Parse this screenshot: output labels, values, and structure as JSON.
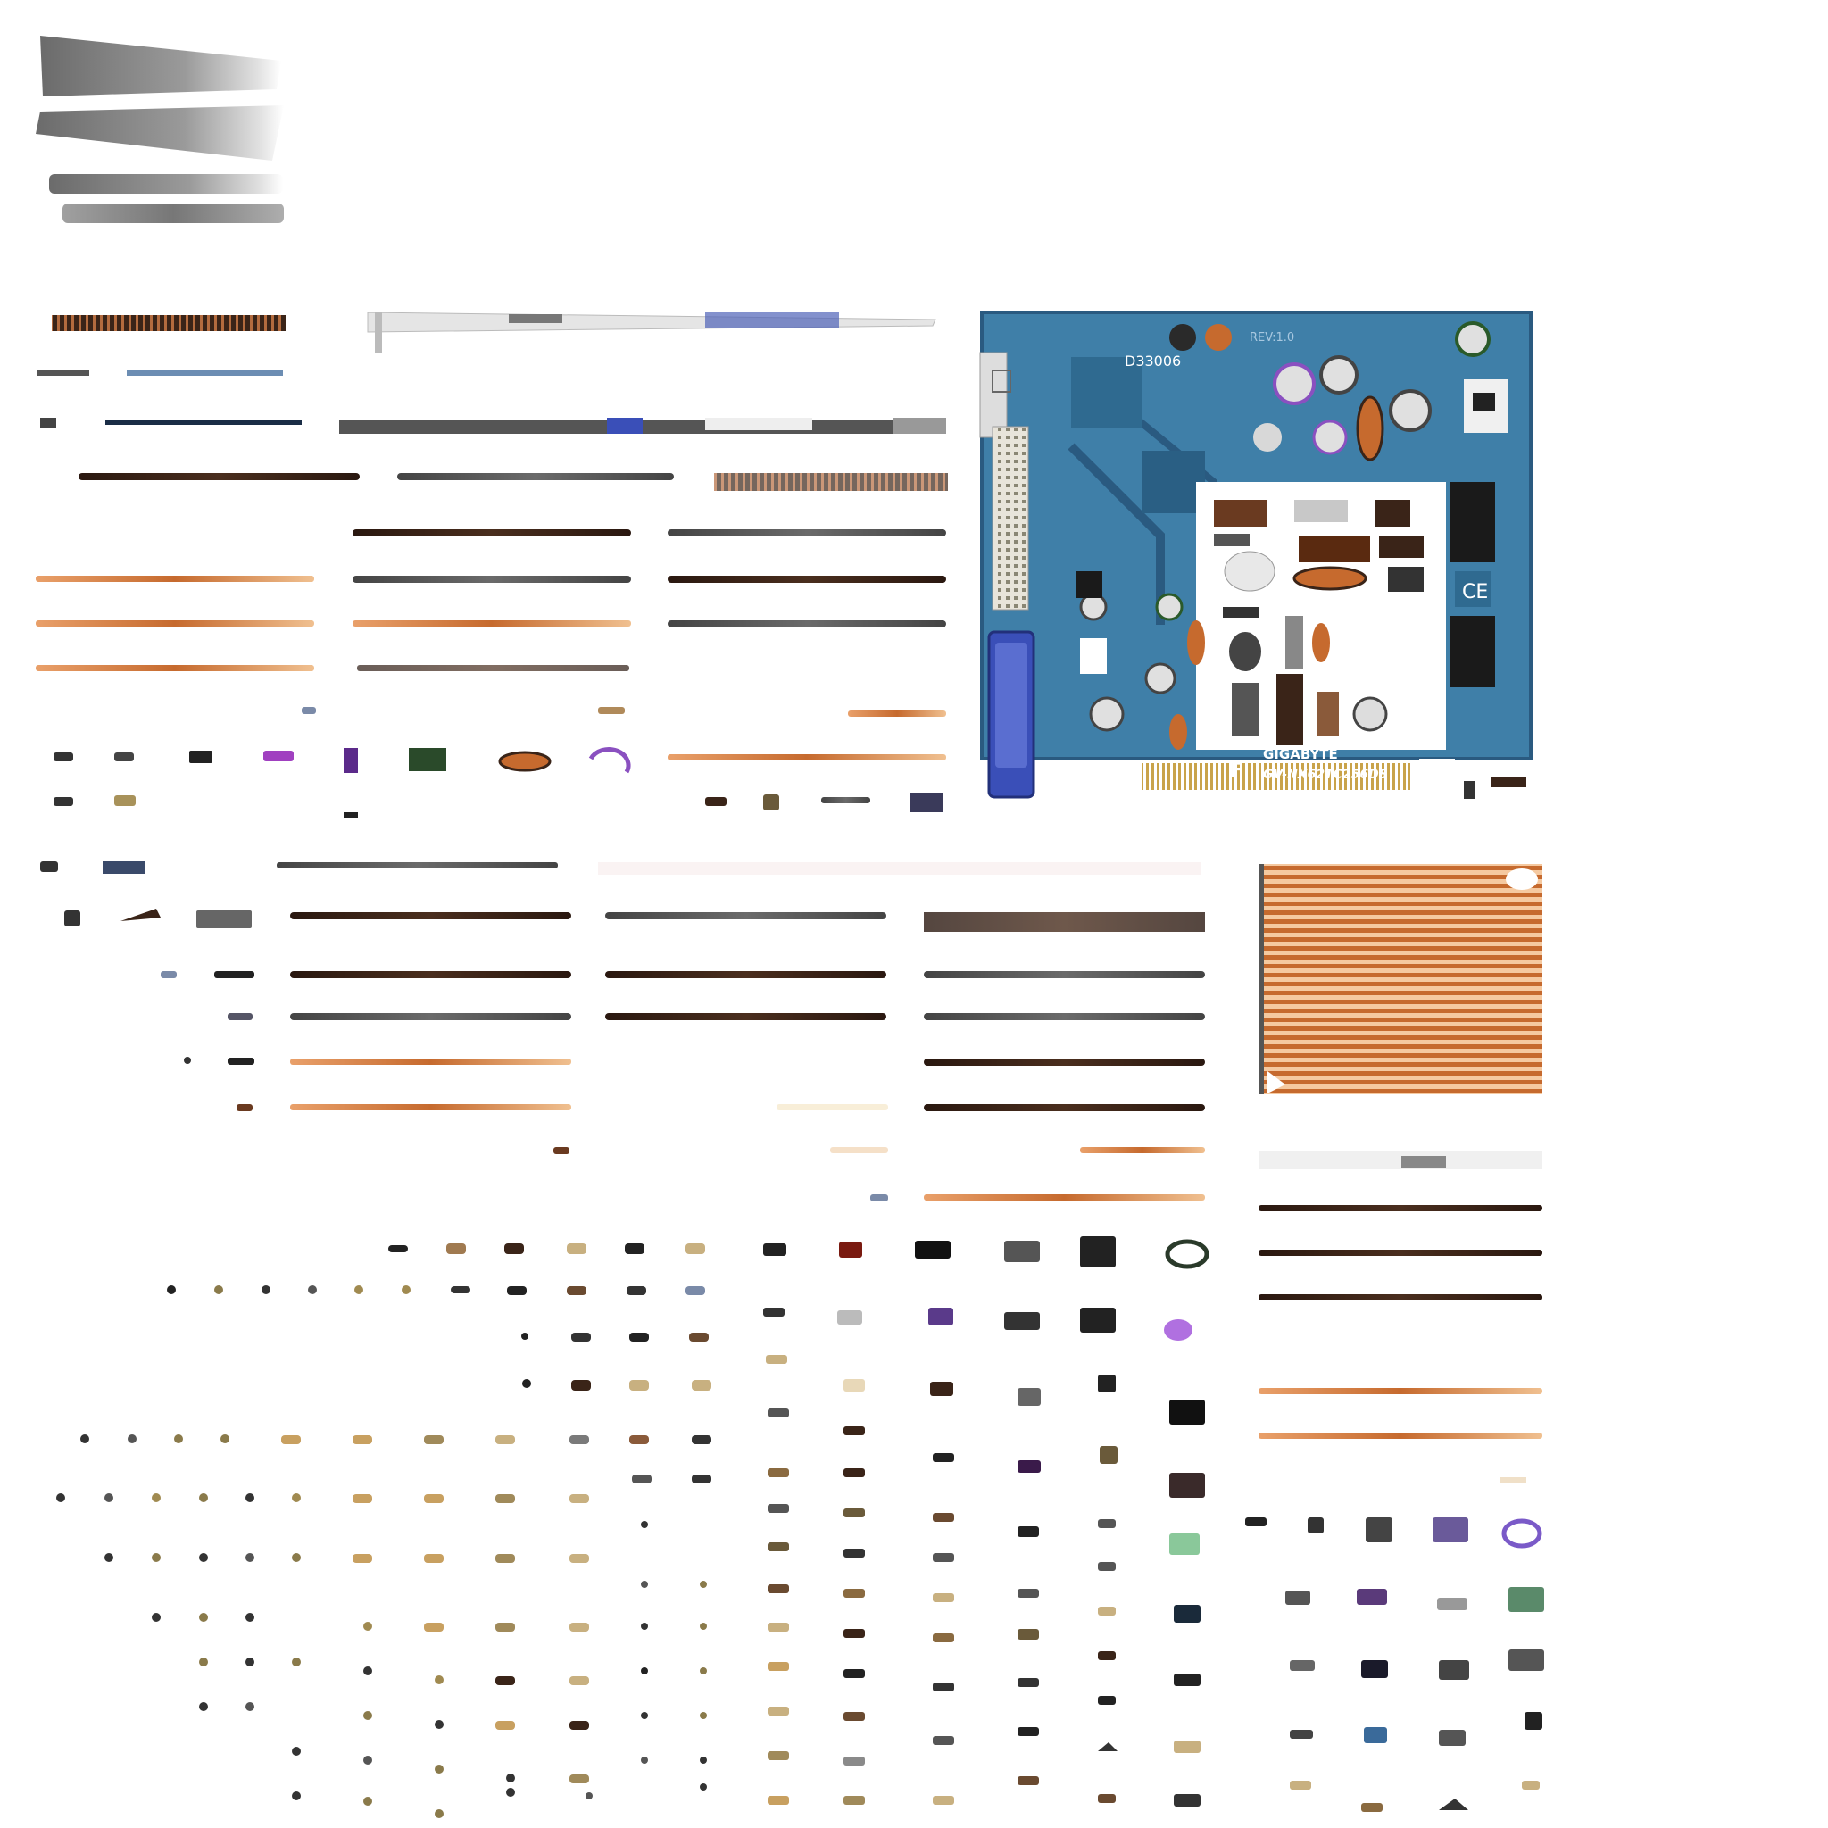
{
  "texture": {
    "pcb_silkscreen": {
      "ref_code": "D33006",
      "revision": "REV:1.0",
      "brand": "GIGABYTE",
      "model": "GV-NX62TC256D8"
    },
    "colors": {
      "pcb_blue": "#3f7fa8",
      "pcb_dark": "#1f4f73",
      "copper": "#c66a2e",
      "copper_light": "#e9a06a",
      "dark_brown": "#3a2418",
      "gray": "#5c5c5c",
      "bracket_gray": "#7a7a7a",
      "vga_blue": "#3a4fb8",
      "gold": "#c9a34a",
      "white": "#ffffff"
    },
    "icons": [
      "ce-mark-icon",
      "fcc-mark-icon",
      "bin-recycle-icon",
      "chip-icon",
      "capacitor-icon",
      "inductor-coil-icon",
      "vga-port-icon",
      "dvi-port-icon",
      "heatsink-fins-icon",
      "bracket-icon"
    ]
  }
}
